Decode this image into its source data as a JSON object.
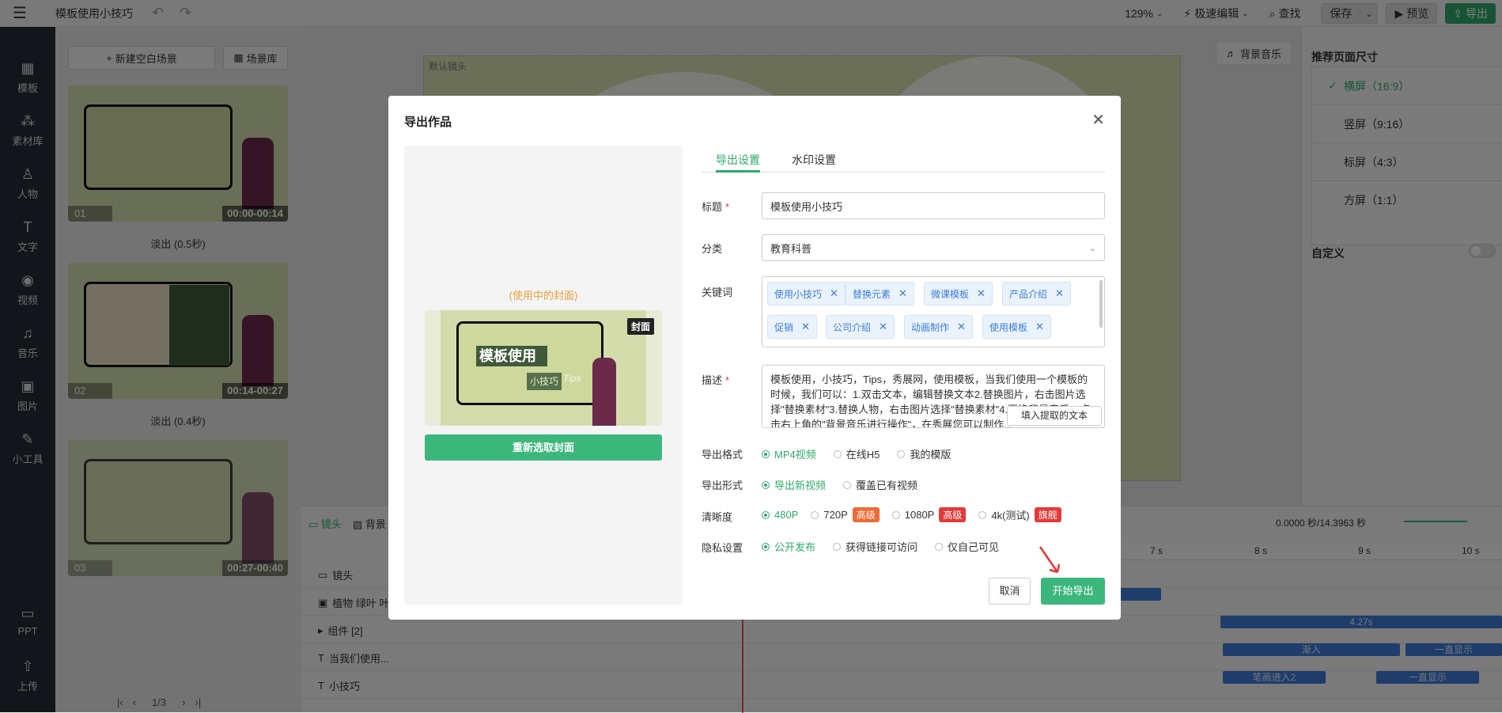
{
  "topbar": {
    "title": "模板使用小技巧",
    "zoom": "129%",
    "mode": "极速编辑",
    "find": "查找",
    "save": "保存",
    "preview": "预览",
    "export": "导出"
  },
  "leftnav": {
    "items": [
      {
        "label": "模板",
        "icon": "template-icon"
      },
      {
        "label": "素材库",
        "icon": "material-icon"
      },
      {
        "label": "人物",
        "icon": "person-icon"
      },
      {
        "label": "文字",
        "icon": "text-icon"
      },
      {
        "label": "视频",
        "icon": "video-icon"
      },
      {
        "label": "音乐",
        "icon": "music-icon"
      },
      {
        "label": "图片",
        "icon": "image-icon"
      },
      {
        "label": "小工具",
        "icon": "tools-icon"
      },
      {
        "label": "PPT",
        "icon": "ppt-icon"
      },
      {
        "label": "上传",
        "icon": "upload-icon"
      }
    ]
  },
  "scenes": {
    "new_blank": "新建空白场景",
    "library": "场景库",
    "items": [
      {
        "num": "01",
        "time": "00:00-00:14",
        "transition": "淡出 (0.5秒)"
      },
      {
        "num": "02",
        "time": "00:14-00:27",
        "transition": "淡出 (0.4秒)"
      },
      {
        "num": "03",
        "time": "00:27-00:40"
      }
    ],
    "pager": "1/3"
  },
  "canvas": {
    "default_shot": "默认镜头",
    "bg_music": "背景音乐"
  },
  "rightpanel": {
    "title": "推荐页面尺寸",
    "sizes": [
      "横屏（16:9）",
      "竖屏（9:16）",
      "标屏（4:3）",
      "方屏（1:1）"
    ],
    "custom": "自定义"
  },
  "timeline": {
    "tab_shot": "镜头",
    "tab_bg": "背景",
    "time_readout": "0.0000 秒/14.3963 秒",
    "ruler": [
      "7 s",
      "8 s",
      "9 s",
      "10 s"
    ],
    "rows": [
      {
        "label": "镜头"
      },
      {
        "label": "植物 绿叶 叶子"
      },
      {
        "label": "组件 [2]"
      },
      {
        "label": "当我们使用..."
      },
      {
        "label": "小技巧"
      }
    ],
    "bar_1": "4.27s",
    "bar_2": "渐入",
    "bar_3": "一直显示",
    "bar_4": "笔画进入2",
    "bar_5": "一直显示"
  },
  "modal": {
    "title": "导出作品",
    "cover_label": "(使用中的封面)",
    "cover_badge": "封面",
    "cover_heading": "模板使用",
    "cover_sub": "小技巧",
    "cover_tips": "Tips",
    "reselect": "重新选取封面",
    "tabs": [
      "导出设置",
      "水印设置"
    ],
    "title_label": "标题",
    "title_value": "模板使用小技巧",
    "category_label": "分类",
    "category_value": "教育科普",
    "keywords_label": "关键词",
    "keywords": [
      "使用小技巧",
      "替换元素",
      "微课模板",
      "产品介绍",
      "促销",
      "公司介绍",
      "动画制作",
      "使用模板"
    ],
    "desc_label": "描述",
    "desc_value": "模板使用，小技巧，Tips，秀展网，使用模板，当我们使用一个模板的时候，我们可以：1.双击文本，编辑替换文本2.替换图片，右击图片选择\"替换素材\"3.替换人物，右击图片选择\"替换素材\"4.更换背景音乐，点击右上角的\"背景音乐进行操作\"，在秀展您可以制作...",
    "fill_text": "填入提取的文本",
    "format_label": "导出格式",
    "formats": [
      "MP4视频",
      "在线H5",
      "我的模版"
    ],
    "form_label": "导出形式",
    "forms": [
      "导出新视频",
      "覆盖已有视频"
    ],
    "quality_label": "清晰度",
    "qualities": [
      "480P",
      "720P",
      "1080P",
      "4k(测试)"
    ],
    "tag_high": "高级",
    "tag_flag": "旗舰",
    "privacy_label": "隐私设置",
    "privacies": [
      "公开发布",
      "获得链接可访问",
      "仅自己可见"
    ],
    "cancel": "取消",
    "start": "开始导出"
  }
}
